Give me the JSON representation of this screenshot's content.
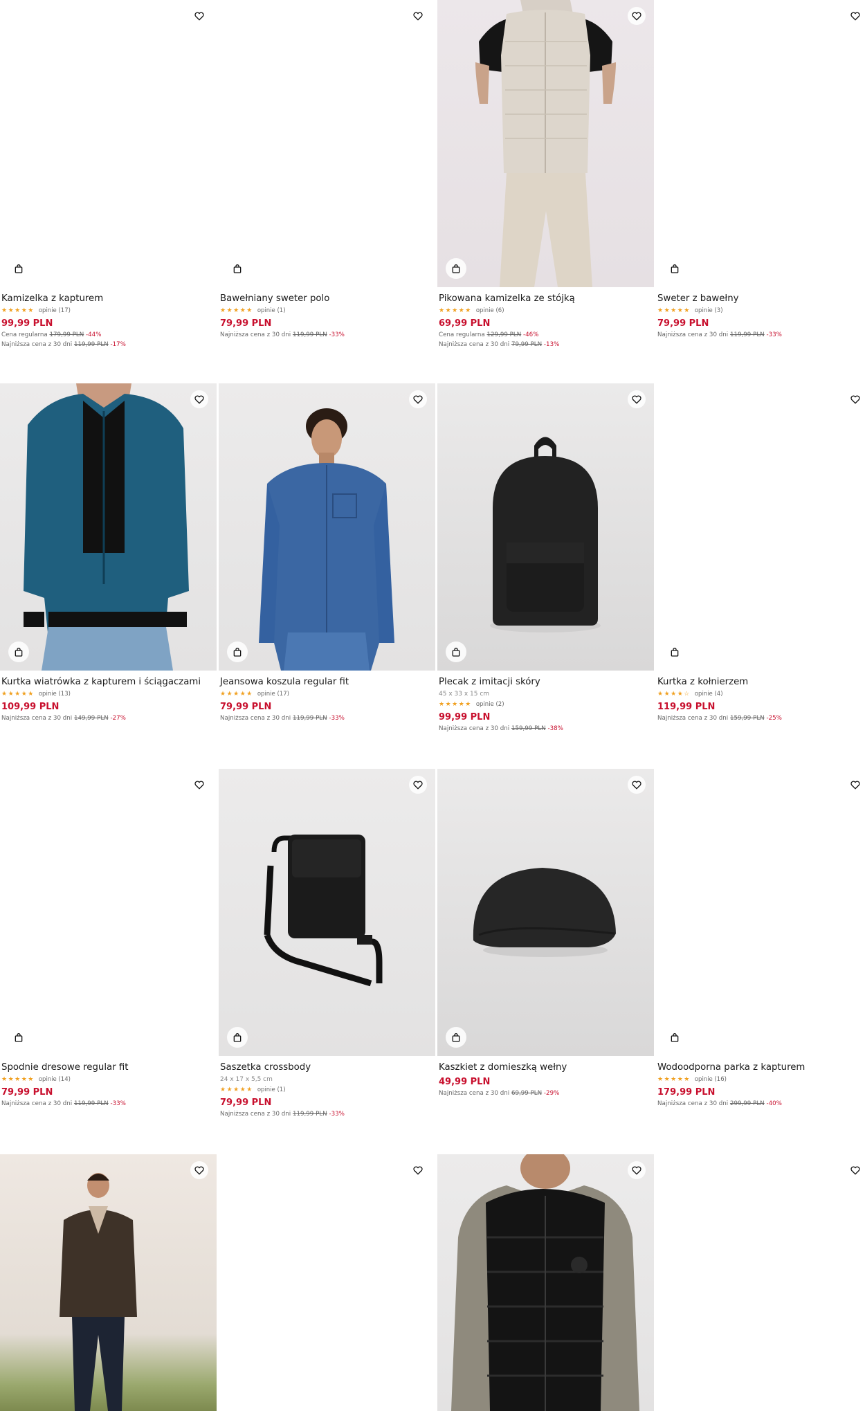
{
  "products": [
    {
      "name": "Kamizelka z kapturem",
      "reviews": "opinie (17)",
      "stars": "★★★★★",
      "price": "99,99 PLN",
      "lines": [
        {
          "label": "Cena regularna",
          "old": "179,99 PLN",
          "pct": "-44%"
        },
        {
          "label": "Najniższa cena z 30 dni",
          "old": "119,99 PLN",
          "pct": "-17%"
        }
      ]
    },
    {
      "name": "Bawełniany sweter polo",
      "reviews": "opinie (1)",
      "stars": "★★★★★",
      "price": "79,99 PLN",
      "lines": [
        {
          "label": "Najniższa cena z 30 dni",
          "old": "119,99 PLN",
          "pct": "-33%"
        }
      ]
    },
    {
      "name": "Pikowana kamizelka ze stójką",
      "reviews": "opinie (6)",
      "stars": "★★★★★",
      "price": "69,99 PLN",
      "lines": [
        {
          "label": "Cena regularna",
          "old": "129,99 PLN",
          "pct": "-46%"
        },
        {
          "label": "Najniższa cena z 30 dni",
          "old": "79,99 PLN",
          "pct": "-13%"
        }
      ]
    },
    {
      "name": "Sweter z bawełny",
      "reviews": "opinie (3)",
      "stars": "★★★★★",
      "price": "79,99 PLN",
      "lines": [
        {
          "label": "Najniższa cena z 30 dni",
          "old": "119,99 PLN",
          "pct": "-33%"
        }
      ]
    },
    {
      "name": "Kurtka wiatrówka z kapturem i ściągaczami",
      "reviews": "opinie (13)",
      "stars": "★★★★★",
      "price": "109,99 PLN",
      "lines": [
        {
          "label": "Najniższa cena z 30 dni",
          "old": "149,99 PLN",
          "pct": "-27%"
        }
      ]
    },
    {
      "name": "Jeansowa koszula regular fit",
      "reviews": "opinie (17)",
      "stars": "★★★★★",
      "price": "79,99 PLN",
      "lines": [
        {
          "label": "Najniższa cena z 30 dni",
          "old": "119,99 PLN",
          "pct": "-33%"
        }
      ]
    },
    {
      "name": "Plecak z imitacji skóry",
      "dims": "45 x 33 x 15 cm",
      "reviews": "opinie (2)",
      "stars": "★★★★★",
      "price": "99,99 PLN",
      "lines": [
        {
          "label": "Najniższa cena z 30 dni",
          "old": "159,99 PLN",
          "pct": "-38%"
        }
      ]
    },
    {
      "name": "Kurtka z kołnierzem",
      "reviews": "opinie (4)",
      "stars": "★★★★☆",
      "price": "119,99 PLN",
      "lines": [
        {
          "label": "Najniższa cena z 30 dni",
          "old": "159,99 PLN",
          "pct": "-25%"
        }
      ]
    },
    {
      "name": "Spodnie dresowe regular fit",
      "reviews": "opinie (14)",
      "stars": "★★★★★",
      "price": "79,99 PLN",
      "lines": [
        {
          "label": "Najniższa cena z 30 dni",
          "old": "119,99 PLN",
          "pct": "-33%"
        }
      ]
    },
    {
      "name": "Saszetka crossbody",
      "dims": "24 x 17 x 5,5 cm",
      "reviews": "opinie (1)",
      "stars": "★★★★★",
      "price": "79,99 PLN",
      "lines": [
        {
          "label": "Najniższa cena z 30 dni",
          "old": "119,99 PLN",
          "pct": "-33%"
        }
      ]
    },
    {
      "name": "Kaszkiet z domieszką wełny",
      "price": "49,99 PLN",
      "lines": [
        {
          "label": "Najniższa cena z 30 dni",
          "old": "69,99 PLN",
          "pct": "-29%"
        }
      ]
    },
    {
      "name": "Wodoodporna parka z kapturem",
      "reviews": "opinie (16)",
      "stars": "★★★★★",
      "price": "179,99 PLN",
      "lines": [
        {
          "label": "Najniższa cena z 30 dni",
          "old": "299,99 PLN",
          "pct": "-40%"
        }
      ]
    }
  ],
  "icons": {
    "favorite": "heart-icon",
    "cart": "shopping-bag-icon"
  },
  "colors": {
    "price": "#c8102e",
    "stars": "#f0a020"
  }
}
